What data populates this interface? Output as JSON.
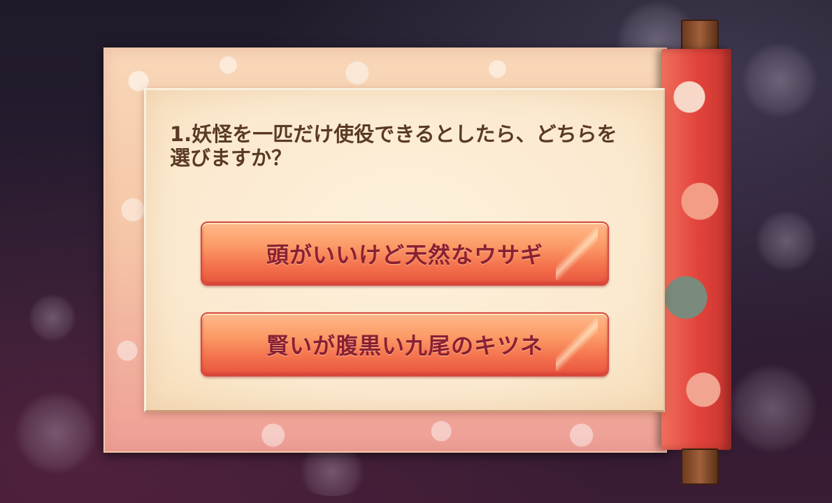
{
  "question": {
    "text": "1.妖怪を一匹だけ使役できるとしたら、どちらを選びますか？"
  },
  "answers": [
    {
      "label": "頭がいいけど天然なウサギ"
    },
    {
      "label": "賢いが腹黒い九尾のキツネ"
    }
  ],
  "colors": {
    "background": "#2a1d32",
    "scroll_paper": "#f5c7a8",
    "panel": "#fbe9cf",
    "question_text": "#5a3a23",
    "button_fill": "#f4724d",
    "button_text": "#8a1f33",
    "scroll_roll": "#e3443c"
  }
}
